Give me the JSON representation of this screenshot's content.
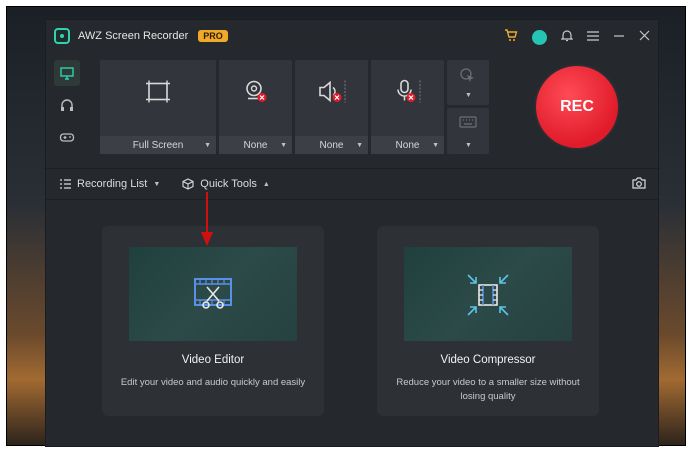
{
  "app": {
    "title": "AWZ Screen Recorder",
    "badge": "PRO"
  },
  "titlebar_icons": [
    "cart-icon",
    "avatar-icon",
    "bell-icon",
    "menu-icon",
    "minimize-icon",
    "close-icon"
  ],
  "sidenav": [
    {
      "name": "screen-icon",
      "active": true
    },
    {
      "name": "headphones-icon",
      "active": false
    },
    {
      "name": "gamepad-icon",
      "active": false
    }
  ],
  "controls": {
    "screen_area": "Full Screen",
    "webcam": "None",
    "speaker": "None",
    "microphone": "None"
  },
  "rec_label": "REC",
  "toolbar": {
    "recording_list": "Recording List",
    "quick_tools": "Quick Tools"
  },
  "tools": {
    "video_editor": {
      "title": "Video Editor",
      "desc": "Edit your video and audio quickly and easily"
    },
    "video_compressor": {
      "title": "Video Compressor",
      "desc": "Reduce your video to a smaller size without losing quality"
    }
  },
  "colors": {
    "accent_teal": "#2fd3b2",
    "rec_red": "#e01b2a",
    "pro_orange": "#f0a92a",
    "annotation_arrow": "#d01010"
  }
}
